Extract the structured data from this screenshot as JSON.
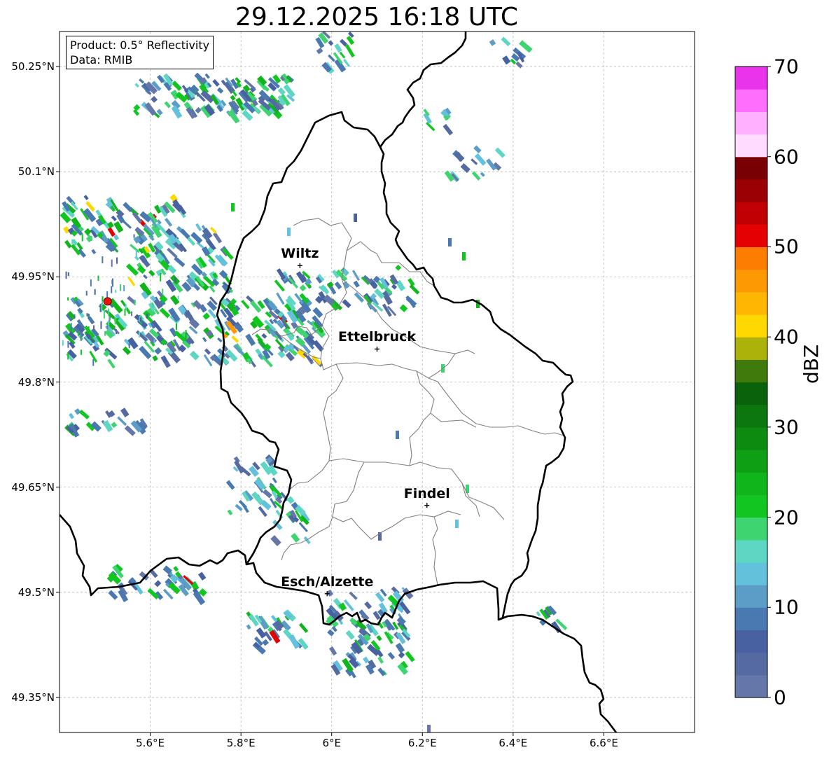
{
  "title": "29.12.2025 16:18 UTC",
  "info": {
    "product": "Product: 0.5° Reflectivity",
    "data": "Data: RMIB"
  },
  "axes": {
    "lon_range": [
      5.4,
      6.8
    ],
    "lat_range": [
      49.3,
      50.3
    ],
    "x_ticks": [
      {
        "value": 5.6,
        "label": "5.6°E"
      },
      {
        "value": 5.8,
        "label": "5.8°E"
      },
      {
        "value": 6.0,
        "label": "6°E"
      },
      {
        "value": 6.2,
        "label": "6.2°E"
      },
      {
        "value": 6.4,
        "label": "6.4°E"
      },
      {
        "value": 6.6,
        "label": "6.6°E"
      }
    ],
    "y_ticks": [
      {
        "value": 49.35,
        "label": "49.35°N"
      },
      {
        "value": 49.5,
        "label": "49.5°N"
      },
      {
        "value": 49.65,
        "label": "49.65°N"
      },
      {
        "value": 49.8,
        "label": "49.8°N"
      },
      {
        "value": 49.95,
        "label": "49.95°N"
      },
      {
        "value": 50.1,
        "label": "50.1°N"
      },
      {
        "value": 50.25,
        "label": "50.25°N"
      }
    ],
    "grid": true
  },
  "cities": [
    {
      "name": "Wiltz",
      "lon": 5.93,
      "lat": 49.966
    },
    {
      "name": "Ettelbruck",
      "lon": 6.1,
      "lat": 49.847
    },
    {
      "name": "Findel",
      "lon": 6.21,
      "lat": 49.624
    },
    {
      "name": "Esch/Alzette",
      "lon": 5.99,
      "lat": 49.498
    }
  ],
  "radar_site": {
    "lon": 5.506,
    "lat": 49.915,
    "color": "#e8140c"
  },
  "colorbar": {
    "label": "dBZ",
    "min": 0,
    "max": 70,
    "ticks": [
      "0",
      "10",
      "20",
      "30",
      "40",
      "50",
      "60",
      "70"
    ],
    "colors": [
      "#6577a8",
      "#566aa2",
      "#4861a0",
      "#4a78b0",
      "#5b9dc6",
      "#64c1dc",
      "#5ed6c4",
      "#3ed46f",
      "#12c621",
      "#10b41b",
      "#0f9f14",
      "#0d8b10",
      "#0c770e",
      "#0a620b",
      "#417a0c",
      "#adb20a",
      "#fed800",
      "#feb602",
      "#fd9903",
      "#fd7d03",
      "#e40003",
      "#c00003",
      "#9b0004",
      "#780004",
      "#ffdcff",
      "#ffb0ff",
      "#ff6efd",
      "#ea34ec"
    ]
  },
  "borders": {
    "country_color": "#000000",
    "canton_color": "#808080"
  }
}
